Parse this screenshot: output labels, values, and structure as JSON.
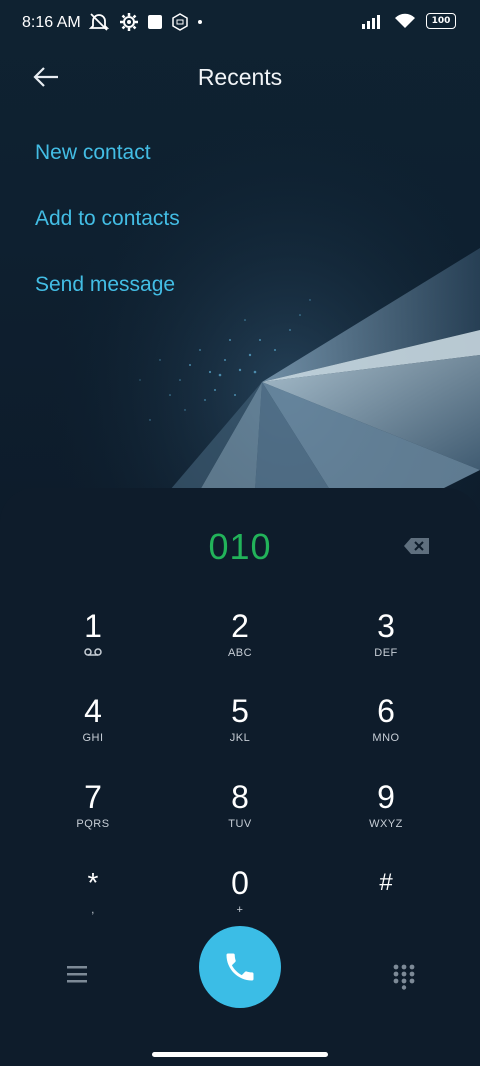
{
  "status_bar": {
    "time": "8:16 AM",
    "battery": "100",
    "icons": [
      "mute-icon",
      "settings-icon",
      "square-icon",
      "nfc-icon",
      "dot-icon",
      "signal-icon",
      "wifi-icon",
      "battery-icon"
    ]
  },
  "header": {
    "title": "Recents",
    "back_icon": "arrow-left-icon"
  },
  "actions": [
    {
      "label": "New contact"
    },
    {
      "label": "Add to contacts"
    },
    {
      "label": "Send message"
    }
  ],
  "dialpad": {
    "number": "010",
    "keys": [
      {
        "digit": "1",
        "letters": ""
      },
      {
        "digit": "2",
        "letters": "ABC"
      },
      {
        "digit": "3",
        "letters": "DEF"
      },
      {
        "digit": "4",
        "letters": "GHI"
      },
      {
        "digit": "5",
        "letters": "JKL"
      },
      {
        "digit": "6",
        "letters": "MNO"
      },
      {
        "digit": "7",
        "letters": "PQRS"
      },
      {
        "digit": "8",
        "letters": "TUV"
      },
      {
        "digit": "9",
        "letters": "WXYZ"
      },
      {
        "digit": "*",
        "letters": ","
      },
      {
        "digit": "0",
        "letters": "+"
      },
      {
        "digit": "#",
        "letters": ""
      }
    ]
  },
  "colors": {
    "accent": "#43bde4",
    "number": "#22b35a",
    "call_button": "#3bbde6",
    "background": "#0d1b2a"
  }
}
